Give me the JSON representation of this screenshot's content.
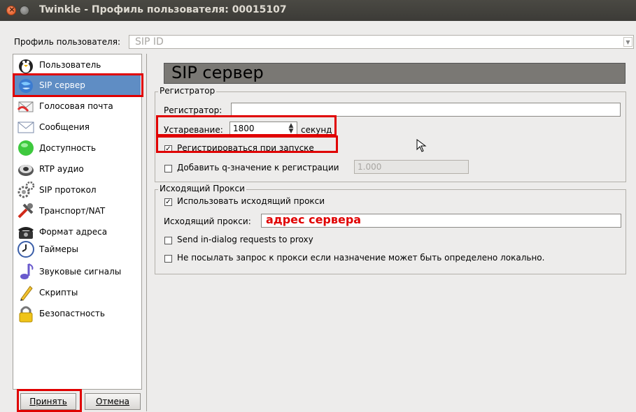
{
  "window": {
    "title": "Twinkle - Профиль пользователя: 00015107"
  },
  "profile": {
    "label": "Профиль пользователя:",
    "value": "SIP ID"
  },
  "sidebar": {
    "items": [
      {
        "label": "Пользователь",
        "icon": "penguin-icon"
      },
      {
        "label": "SIP сервер",
        "icon": "globe-icon",
        "selected": true
      },
      {
        "label": "Голосовая почта",
        "icon": "voicemail-icon"
      },
      {
        "label": "Сообщения",
        "icon": "envelope-icon"
      },
      {
        "label": "Доступность",
        "icon": "presence-icon"
      },
      {
        "label": "RTP аудио",
        "icon": "speaker-icon"
      },
      {
        "label": "SIP протокол",
        "icon": "gears-icon"
      },
      {
        "label": "Транспорт/NAT",
        "icon": "tools-icon"
      },
      {
        "label": "Формат адреса",
        "icon": "phone-icon"
      },
      {
        "label": "Таймеры",
        "icon": "clock-icon"
      },
      {
        "label": "Звуковые сигналы",
        "icon": "music-note-icon"
      },
      {
        "label": "Скрипты",
        "icon": "pen-icon"
      },
      {
        "label": "Безопастность",
        "icon": "lock-icon"
      }
    ]
  },
  "buttons": {
    "accept": "Принять",
    "cancel": "Отмена"
  },
  "main": {
    "header": "SIP сервер",
    "registrar_group": {
      "title": "Регистратор",
      "registrar_label": "Регистратор:",
      "registrar_value": "",
      "expiry_label": "Устаревание:",
      "expiry_value": "1800",
      "expiry_unit": "секунд",
      "register_at_startup_label": "Регистрироваться при запуске",
      "register_at_startup_checked": true,
      "add_q_label": "Добавить q-значение к регистрации",
      "add_q_checked": false,
      "q_value": "1.000"
    },
    "proxy_group": {
      "title": "Исходящий Прокси",
      "use_proxy_label": "Использовать исходящий прокси",
      "use_proxy_checked": true,
      "proxy_label": "Исходящий прокси:",
      "proxy_value": "адрес сервера",
      "in_dialog_label": "Send in-dialog requests to proxy",
      "in_dialog_checked": false,
      "no_proxy_local_label": "Не посылать запрос к прокси если назначение может быть определено локально.",
      "no_proxy_local_checked": false
    }
  },
  "colors": {
    "highlight": "#e00000",
    "selection": "#5f8dc4",
    "proxy_text": "#e00000"
  }
}
